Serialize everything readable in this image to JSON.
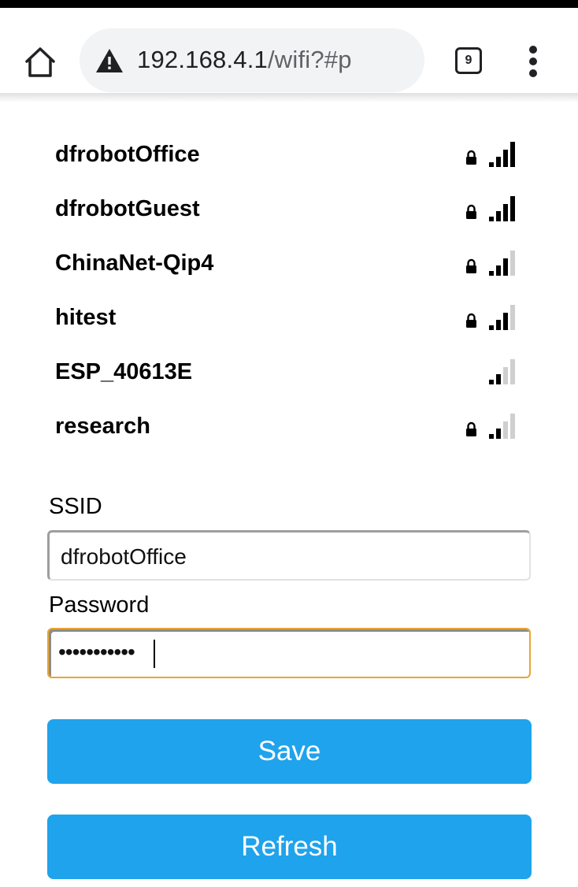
{
  "browser": {
    "url_host": "192.168.4.1",
    "url_path": "/wifi?#p",
    "tab_count": "9",
    "icons": [
      "home-icon",
      "security-warning-icon",
      "tab-switcher-icon",
      "more-menu-icon"
    ]
  },
  "networks": [
    {
      "ssid": "dfrobotOffice",
      "locked": true,
      "signal": 4
    },
    {
      "ssid": "dfrobotGuest",
      "locked": true,
      "signal": 4
    },
    {
      "ssid": "ChinaNet-Qip4",
      "locked": true,
      "signal": 3
    },
    {
      "ssid": "hitest",
      "locked": true,
      "signal": 3
    },
    {
      "ssid": "ESP_40613E",
      "locked": false,
      "signal": 2
    },
    {
      "ssid": "research",
      "locked": true,
      "signal": 2
    }
  ],
  "form": {
    "ssid_label": "SSID",
    "ssid_value": "dfrobotOffice",
    "password_label": "Password",
    "password_masked": "•••••••••••",
    "save_label": "Save",
    "refresh_label": "Refresh"
  },
  "colors": {
    "button": "#1fa3ec",
    "focus_border": "#e8a532",
    "signal_on": "#000000",
    "signal_off": "#cfcfcf"
  }
}
